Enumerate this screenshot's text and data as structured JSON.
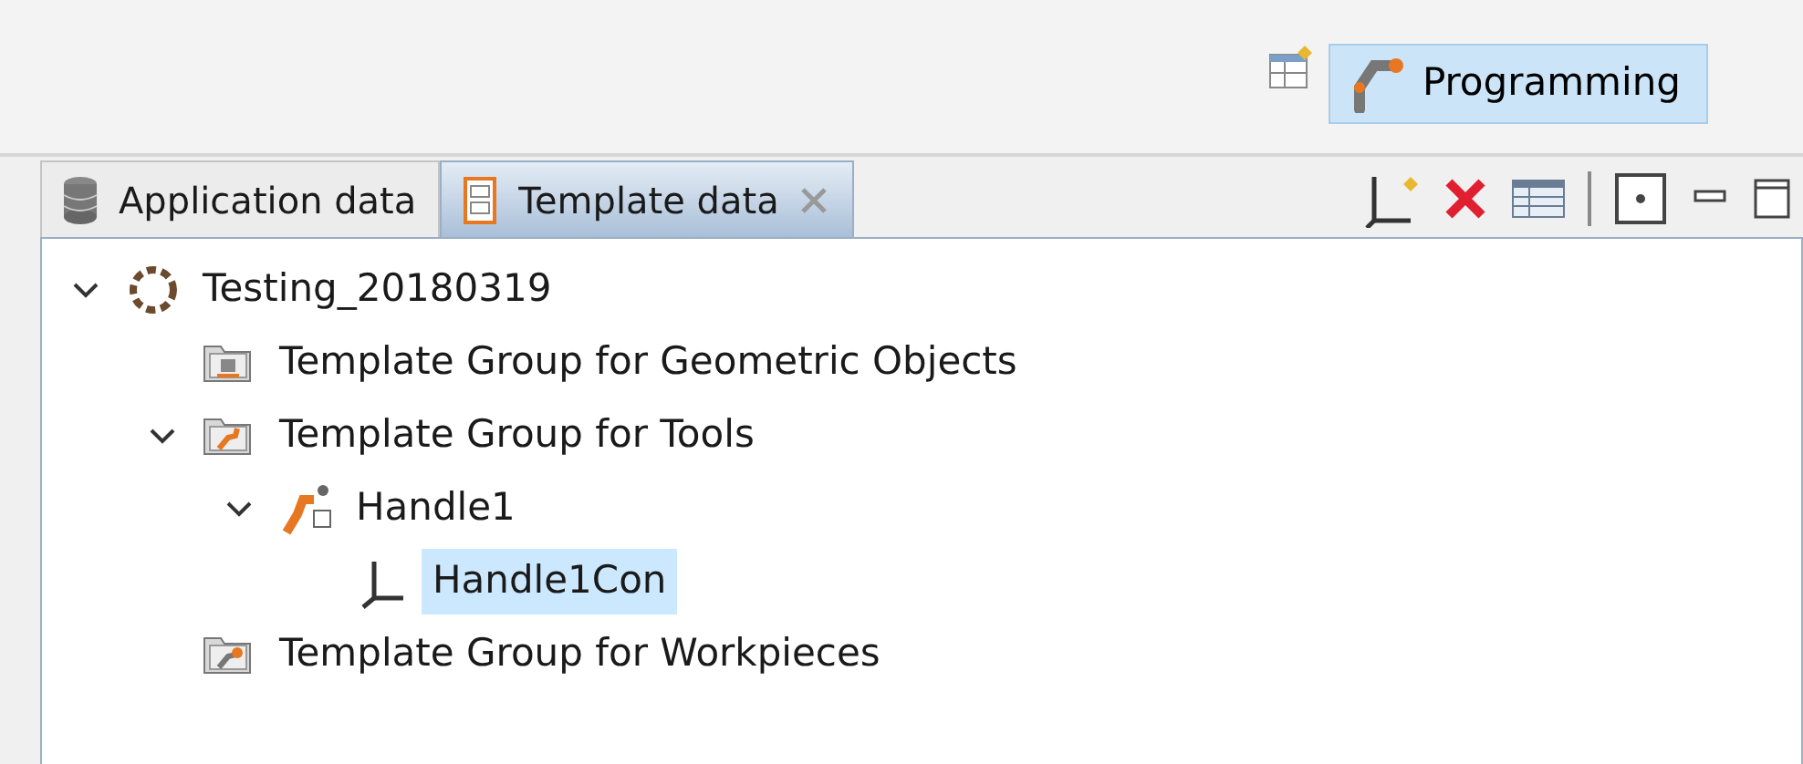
{
  "perspective": {
    "label": "Programming",
    "selected": true
  },
  "tabs": [
    {
      "label": "Application data",
      "selected": false,
      "kind": "database"
    },
    {
      "label": "Template data",
      "selected": true,
      "kind": "template"
    }
  ],
  "tree": [
    {
      "label": "Testing_20180319",
      "kind": "project",
      "expanded": true,
      "selected": false,
      "children": [
        {
          "label": "Template Group for Geometric Objects",
          "kind": "geometry-group",
          "selected": false
        },
        {
          "label": "Template Group for Tools",
          "kind": "tool-group",
          "expanded": true,
          "selected": false,
          "children": [
            {
              "label": "Handle1",
              "kind": "tool",
              "expanded": true,
              "selected": false,
              "children": [
                {
                  "label": "Handle1Con",
                  "kind": "frame",
                  "selected": true
                }
              ]
            }
          ]
        },
        {
          "label": "Template Group for Workpieces",
          "kind": "workpiece-group",
          "selected": false
        }
      ]
    }
  ]
}
